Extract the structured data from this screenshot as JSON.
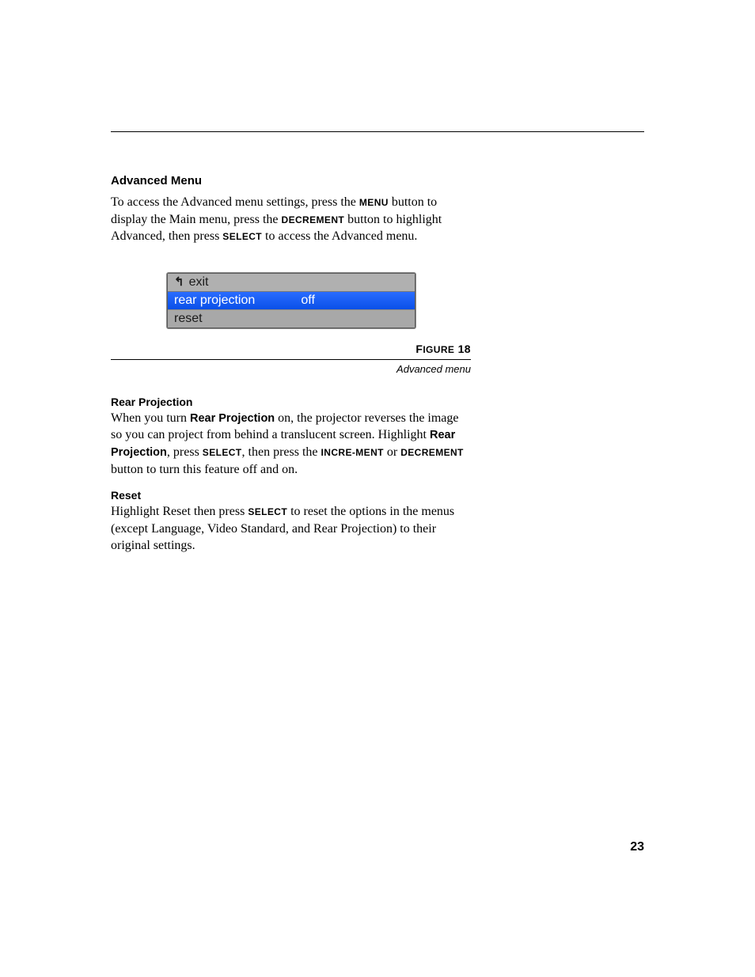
{
  "page_number": "23",
  "section_title": "Advanced Menu",
  "intro": {
    "t1": "To access the Advanced menu settings, press the ",
    "b1": "menu",
    "t2": " button to display the Main menu, press the ",
    "b2": "decrement",
    "t3": " button to highlight Advanced, then press ",
    "b3": "select",
    "t4": " to access the Advanced menu."
  },
  "menu": {
    "exit_label": "exit",
    "row_label": "rear projection",
    "row_value": "off",
    "reset_label": "reset"
  },
  "figure": {
    "label_prefix": "F",
    "label_rest": "IGURE",
    "number": " 18",
    "caption": "Advanced menu"
  },
  "rear_projection": {
    "heading": "Rear Projection",
    "t1": "When you turn ",
    "b1": "Rear Projection",
    "t2": " on, the projector reverses the image so you can project from behind a translucent screen. Highlight ",
    "b2": "Rear Projection",
    "t3": ", press ",
    "b3": "select",
    "t4": ", then press the ",
    "b4": "incre-ment",
    "t5": " or ",
    "b5": "decrement",
    "t6": " button to turn this feature off and on."
  },
  "reset": {
    "heading": "Reset",
    "t1": "Highlight Reset then press ",
    "b1": "select",
    "t2": " to reset the options in the menus (except Language, Video Standard, and Rear Projection) to their original settings."
  }
}
